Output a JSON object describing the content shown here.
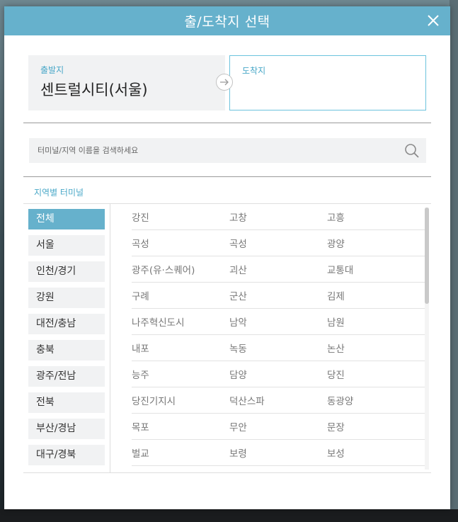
{
  "modal": {
    "title": "출/도착지 선택"
  },
  "route": {
    "depart": {
      "label": "출발지",
      "value": "센트럴시티(서울)"
    },
    "arrive": {
      "label": "도착지",
      "value": ""
    }
  },
  "search": {
    "placeholder": "터미널/지역 이름을 검색하세요"
  },
  "regions": {
    "title": "지역별 터미널",
    "items": [
      "전체",
      "서울",
      "인천/경기",
      "강원",
      "대전/충남",
      "충북",
      "광주/전남",
      "전북",
      "부산/경남",
      "대구/경북"
    ],
    "selected": "전체"
  },
  "terminals": [
    [
      "강진",
      "고창",
      "고흥"
    ],
    [
      "곡성",
      "곡성",
      "광양"
    ],
    [
      "광주(유·스퀘어)",
      "괴산",
      "교통대"
    ],
    [
      "구례",
      "군산",
      "김제"
    ],
    [
      "나주혁신도시",
      "남악",
      "남원"
    ],
    [
      "내포",
      "녹동",
      "논산"
    ],
    [
      "능주",
      "담양",
      "당진"
    ],
    [
      "당진기지시",
      "덕산스파",
      "동광양"
    ],
    [
      "목포",
      "무안",
      "문장"
    ],
    [
      "벌교",
      "보령",
      "보성"
    ]
  ],
  "colors": {
    "accent": "#66b1cc",
    "arrive_border": "#6cc3dd",
    "label": "#4aa8c8"
  }
}
